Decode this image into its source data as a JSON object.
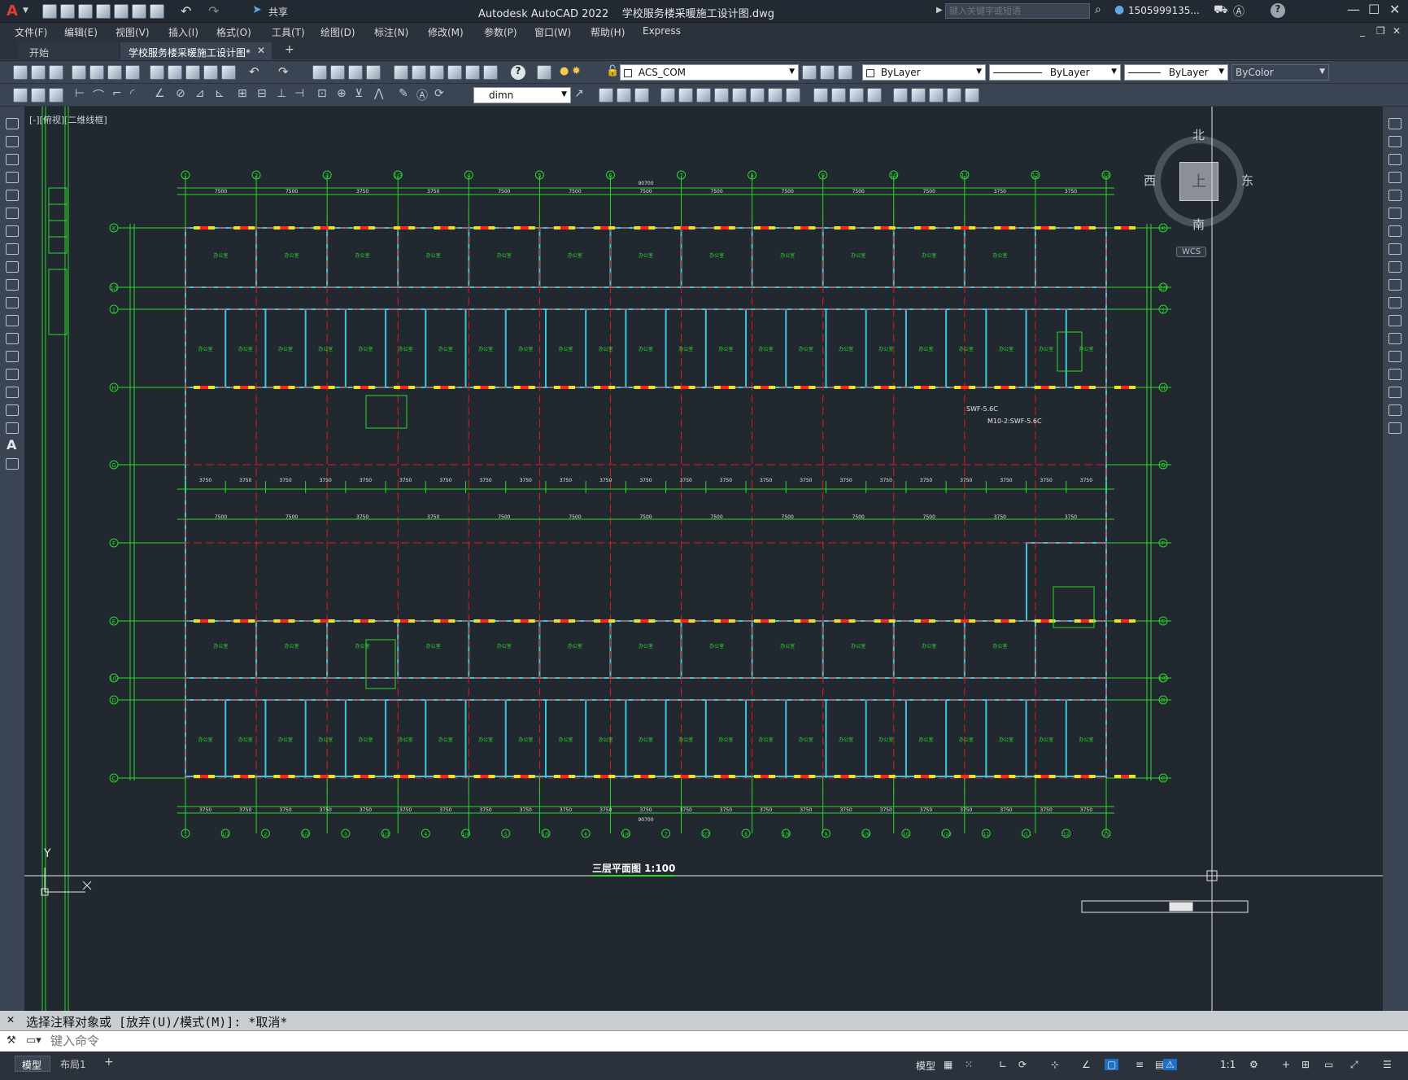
{
  "window": {
    "title": "Autodesk AutoCAD 2022    学校服务楼采暖施工设计图.dwg",
    "app_logo": "A",
    "share_label": "共享",
    "search_placeholder": "键入关键字或短语",
    "user_label": "1505999135...",
    "help_label": "?"
  },
  "menu": [
    "文件(F)",
    "编辑(E)",
    "视图(V)",
    "插入(I)",
    "格式(O)",
    "工具(T)",
    "绘图(D)",
    "标注(N)",
    "修改(M)",
    "参数(P)",
    "窗口(W)",
    "帮助(H)",
    "Express"
  ],
  "tabs": [
    {
      "label": "开始",
      "active": false
    },
    {
      "label": "学校服务楼采暖施工设计图*",
      "active": true
    }
  ],
  "toolbar": {
    "layer": "ACS_COM",
    "color": "ByLayer",
    "linetype": "ByLayer",
    "lineweight": "ByLayer",
    "plotstyle": "ByColor",
    "dimstyle": "dimn"
  },
  "viewport": {
    "label": "[-][俯视][二维线框]",
    "compass": {
      "n": "北",
      "s": "南",
      "w": "西",
      "e": "东",
      "top": "上"
    },
    "wcs": "WCS",
    "ucs_y": "Y",
    "drawing_title": "三层平面图 1:100"
  },
  "plan": {
    "grid_top": [
      "1",
      "2",
      "3",
      "1/3",
      "4",
      "5",
      "6",
      "7",
      "8",
      "9",
      "10",
      "11",
      "12",
      "13"
    ],
    "grid_bottom": [
      "1",
      "1/1",
      "2",
      "1/2",
      "3",
      "1/3",
      "4",
      "1/4",
      "5",
      "1/5",
      "6",
      "1/6",
      "7",
      "1/7",
      "8",
      "1/8",
      "9",
      "1/9",
      "10",
      "1/10",
      "11",
      "1/11",
      "12",
      "13"
    ],
    "grid_left": [
      "K",
      "1/J",
      "J",
      "H",
      "G",
      "F",
      "E",
      "1/D",
      "D",
      "C"
    ],
    "top_dims": [
      "7500",
      "7500",
      "3750",
      "3750",
      "7500",
      "7500",
      "7500",
      "7500",
      "7500",
      "7500",
      "7500",
      "3750",
      "3750"
    ],
    "total_dim": "90700",
    "bottom_dims": [
      "3750",
      "3750",
      "3750",
      "3750",
      "3750",
      "3750",
      "3750",
      "3750",
      "3750",
      "3750",
      "3750",
      "3750",
      "3750",
      "3750",
      "3750",
      "3750",
      "3750",
      "3750",
      "3750",
      "3750",
      "3750",
      "3750",
      "3750"
    ],
    "room_label": "办公室",
    "equip_note": "SWF-5.6C",
    "equip_note2": "M10-2:SWF-5.6C"
  },
  "command": {
    "history": "选择注释对象或 [放弃(U)/模式(M)]: *取消*",
    "placeholder": "键入命令"
  },
  "status": {
    "model_label": "模型",
    "tabs": [
      "模型",
      "布局1"
    ],
    "add_tab": "+",
    "scale": "1:1"
  },
  "colors": {
    "grid": "#2bd82b",
    "wall": "#3cc6d8",
    "axis": "#e01b1b",
    "window": "#e8e32a",
    "text": "#2bd82b"
  }
}
